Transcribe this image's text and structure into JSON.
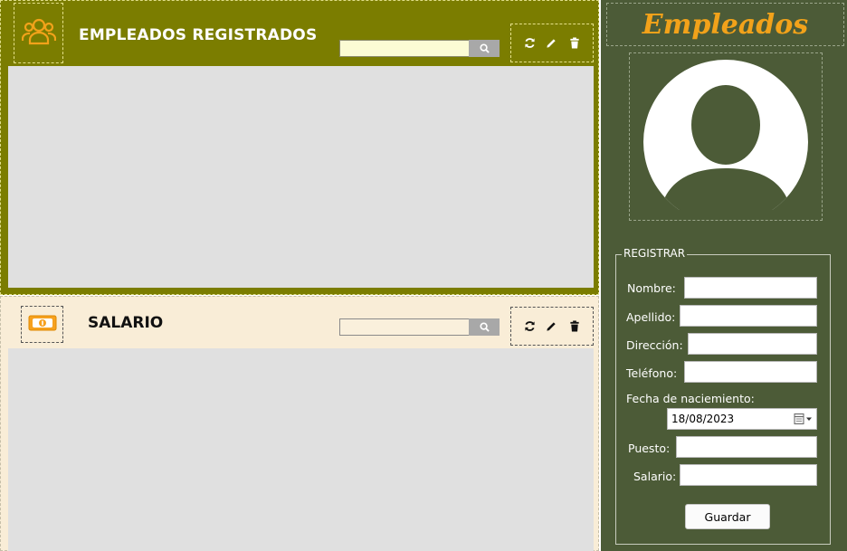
{
  "colors": {
    "top_panel_bg": "#7b7d00",
    "bottom_panel_bg": "#f9edd7",
    "right_panel_bg": "#4c5b37",
    "accent_orange": "#f2a21a",
    "grid_bg": "#e0e0e0"
  },
  "employees_panel": {
    "title": "EMPLEADOS REGISTRADOS",
    "icon": "users-icon",
    "search": {
      "value": "",
      "placeholder": ""
    },
    "actions": [
      "refresh-icon",
      "edit-icon",
      "delete-icon"
    ]
  },
  "salary_panel": {
    "title": "SALARIO",
    "icon": "money-icon",
    "search": {
      "value": "",
      "placeholder": ""
    },
    "actions": [
      "refresh-icon",
      "edit-icon",
      "delete-icon"
    ]
  },
  "sidebar": {
    "title": "Empleados",
    "photo_icon": "user-avatar-icon",
    "register": {
      "legend": "REGISTRAR",
      "fields": {
        "nombre": {
          "label": "Nombre:",
          "value": ""
        },
        "apellido": {
          "label": "Apellido:",
          "value": ""
        },
        "direccion": {
          "label": "Dirección:",
          "value": ""
        },
        "telefono": {
          "label": "Teléfono:",
          "value": ""
        },
        "fecha": {
          "label": "Fecha de naciemiento:",
          "value": "18/08/2023"
        },
        "puesto": {
          "label": "Puesto:",
          "value": ""
        },
        "salario": {
          "label": "Salario:",
          "value": ""
        }
      },
      "save_label": "Guardar"
    }
  }
}
